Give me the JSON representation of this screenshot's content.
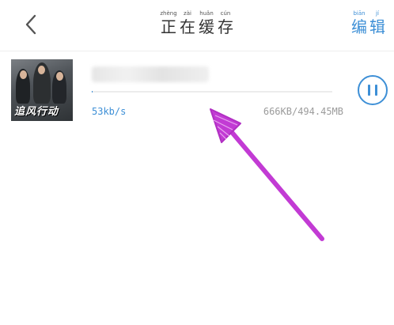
{
  "header": {
    "title_chars": [
      {
        "pinyin": "zhèng",
        "char": "正"
      },
      {
        "pinyin": "zài",
        "char": "在"
      },
      {
        "pinyin": "huǎn",
        "char": "缓"
      },
      {
        "pinyin": "cún",
        "char": "存"
      }
    ],
    "edit_chars": [
      {
        "pinyin": "biān",
        "char": "编"
      },
      {
        "pinyin": "jí",
        "char": "辑"
      }
    ]
  },
  "download": {
    "poster_text": "追风行动",
    "speed": "53kb/s",
    "size": "666KB/494.45MB",
    "progress_fraction": 0.0013
  },
  "colors": {
    "accent": "#3d8fd6",
    "annotation": "#c23bd4"
  }
}
